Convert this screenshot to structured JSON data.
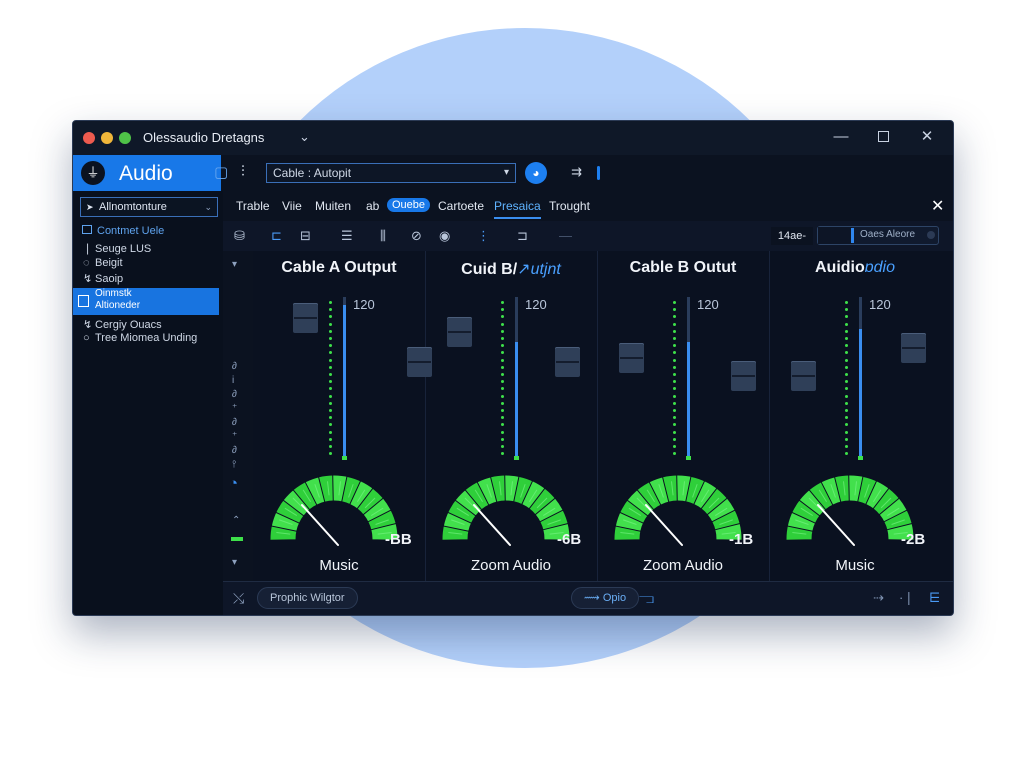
{
  "window": {
    "title": "Olessaudio Dretagns",
    "title_chevron": "⌄",
    "minimize": "—",
    "close": "✕"
  },
  "toolbar": {
    "app_name": "Audio",
    "app_logo_icon": "waveform-logo",
    "select_value": "Cable : Autopit",
    "select_caret": "▾",
    "icon_screen": "▢",
    "icon_tune": "⫶",
    "icon_badge": "◕",
    "icon_route": "⇉"
  },
  "sidebar": {
    "dropdown": "Allnomtonture",
    "dropdown_arrow": "➤",
    "dropdown_caret": "⌄",
    "section": "Contmet Uele",
    "items": [
      {
        "icon": "❘",
        "label": "Seuge LUS"
      },
      {
        "icon": "◌",
        "label": "Beigit"
      },
      {
        "icon": "↯",
        "label": "Saoip"
      },
      {
        "label_line1": "Oinmstk",
        "label_line2": "Altioneder"
      },
      {
        "icon": "↯",
        "label": "Cergiy Ouacs"
      },
      {
        "icon": "○",
        "label": "Tree Miomea Unding"
      }
    ]
  },
  "tabs": {
    "items": [
      "Trable",
      "Viie",
      "Muiten",
      "ab",
      "Ouebe",
      "Cartoete",
      "Presaica",
      "Trought"
    ],
    "pill_index": 4,
    "active_index": 6,
    "close": "✕"
  },
  "iconrow": {
    "icons": [
      "⛁",
      "⊏",
      "⊟",
      "☰",
      "⫼",
      "⊘",
      "◉",
      "⋮",
      "⊐",
      "—"
    ],
    "value": "14ae-",
    "field_text": "Oaes Aleore"
  },
  "strip": {
    "top": "▾",
    "marks": [
      "∂",
      "i",
      "∂",
      "⁺",
      "∂",
      "⁺",
      "∂",
      "⫯"
    ],
    "knob": "◔",
    "lower": "⌃",
    "bottom": "▾"
  },
  "channels": [
    {
      "title": "Cable A Output",
      "title_accent": "",
      "max_label": "120",
      "level": 0.95,
      "dial": 0.25,
      "db": "-BB",
      "source": "Music"
    },
    {
      "title": "Cuid B/",
      "title_accent": "↗utjnt",
      "max_label": "120",
      "level": 0.72,
      "dial": 0.25,
      "db": "-6B",
      "source": "Zoom Audio"
    },
    {
      "title": "Cable B Outut",
      "title_accent": "",
      "max_label": "120",
      "level": 0.72,
      "dial": 0.25,
      "db": "-1B",
      "source": "Zoom Audio"
    },
    {
      "title": "Auidio",
      "title_accent": "ɒdio",
      "max_label": "120",
      "level": 0.8,
      "dial": 0.18,
      "db": "-2B",
      "source": "Music"
    }
  ],
  "bottombar": {
    "tool_icon": "⤯",
    "preset_button": "Prophic Wilgtor",
    "center_button": "⟿ Opio",
    "center_icon": "⫎",
    "right_icons": [
      "⇢",
      "·❘",
      "⋿"
    ]
  },
  "colors": {
    "accent": "#1878e8",
    "meter_green": "#3ee04a",
    "background": "#0c1322"
  }
}
